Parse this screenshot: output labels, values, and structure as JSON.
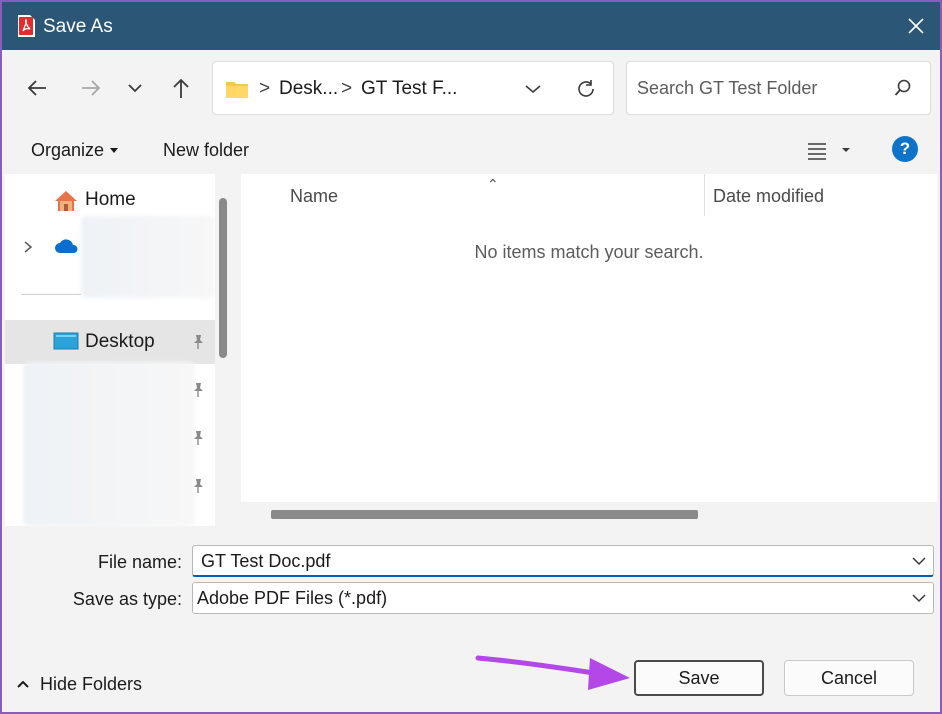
{
  "window": {
    "title": "Save As",
    "app_icon": "acrobat-pdf-icon"
  },
  "address": {
    "crumbs": [
      "Desk...",
      "GT Test F..."
    ],
    "separator": ">"
  },
  "search": {
    "placeholder": "Search GT Test Folder"
  },
  "commandbar": {
    "organize": "Organize",
    "new_folder": "New folder"
  },
  "nav": {
    "items": [
      {
        "label": "Home",
        "icon": "home-icon"
      },
      {
        "label": "Desktop",
        "icon": "desktop-icon",
        "pinned": true
      }
    ]
  },
  "files": {
    "columns": {
      "name": "Name",
      "date_modified": "Date modified"
    },
    "empty_message": "No items match your search."
  },
  "form": {
    "file_name_label": "File name:",
    "file_name_value": "GT Test Doc.pdf",
    "save_as_type_label": "Save as type:",
    "save_as_type_value": "Adobe PDF Files (*.pdf)"
  },
  "footer": {
    "hide_folders": "Hide Folders",
    "save": "Save",
    "cancel": "Cancel"
  },
  "colors": {
    "titlebar": "#2b5676",
    "annotation_arrow": "#b347e8",
    "help": "#0f73c9"
  }
}
